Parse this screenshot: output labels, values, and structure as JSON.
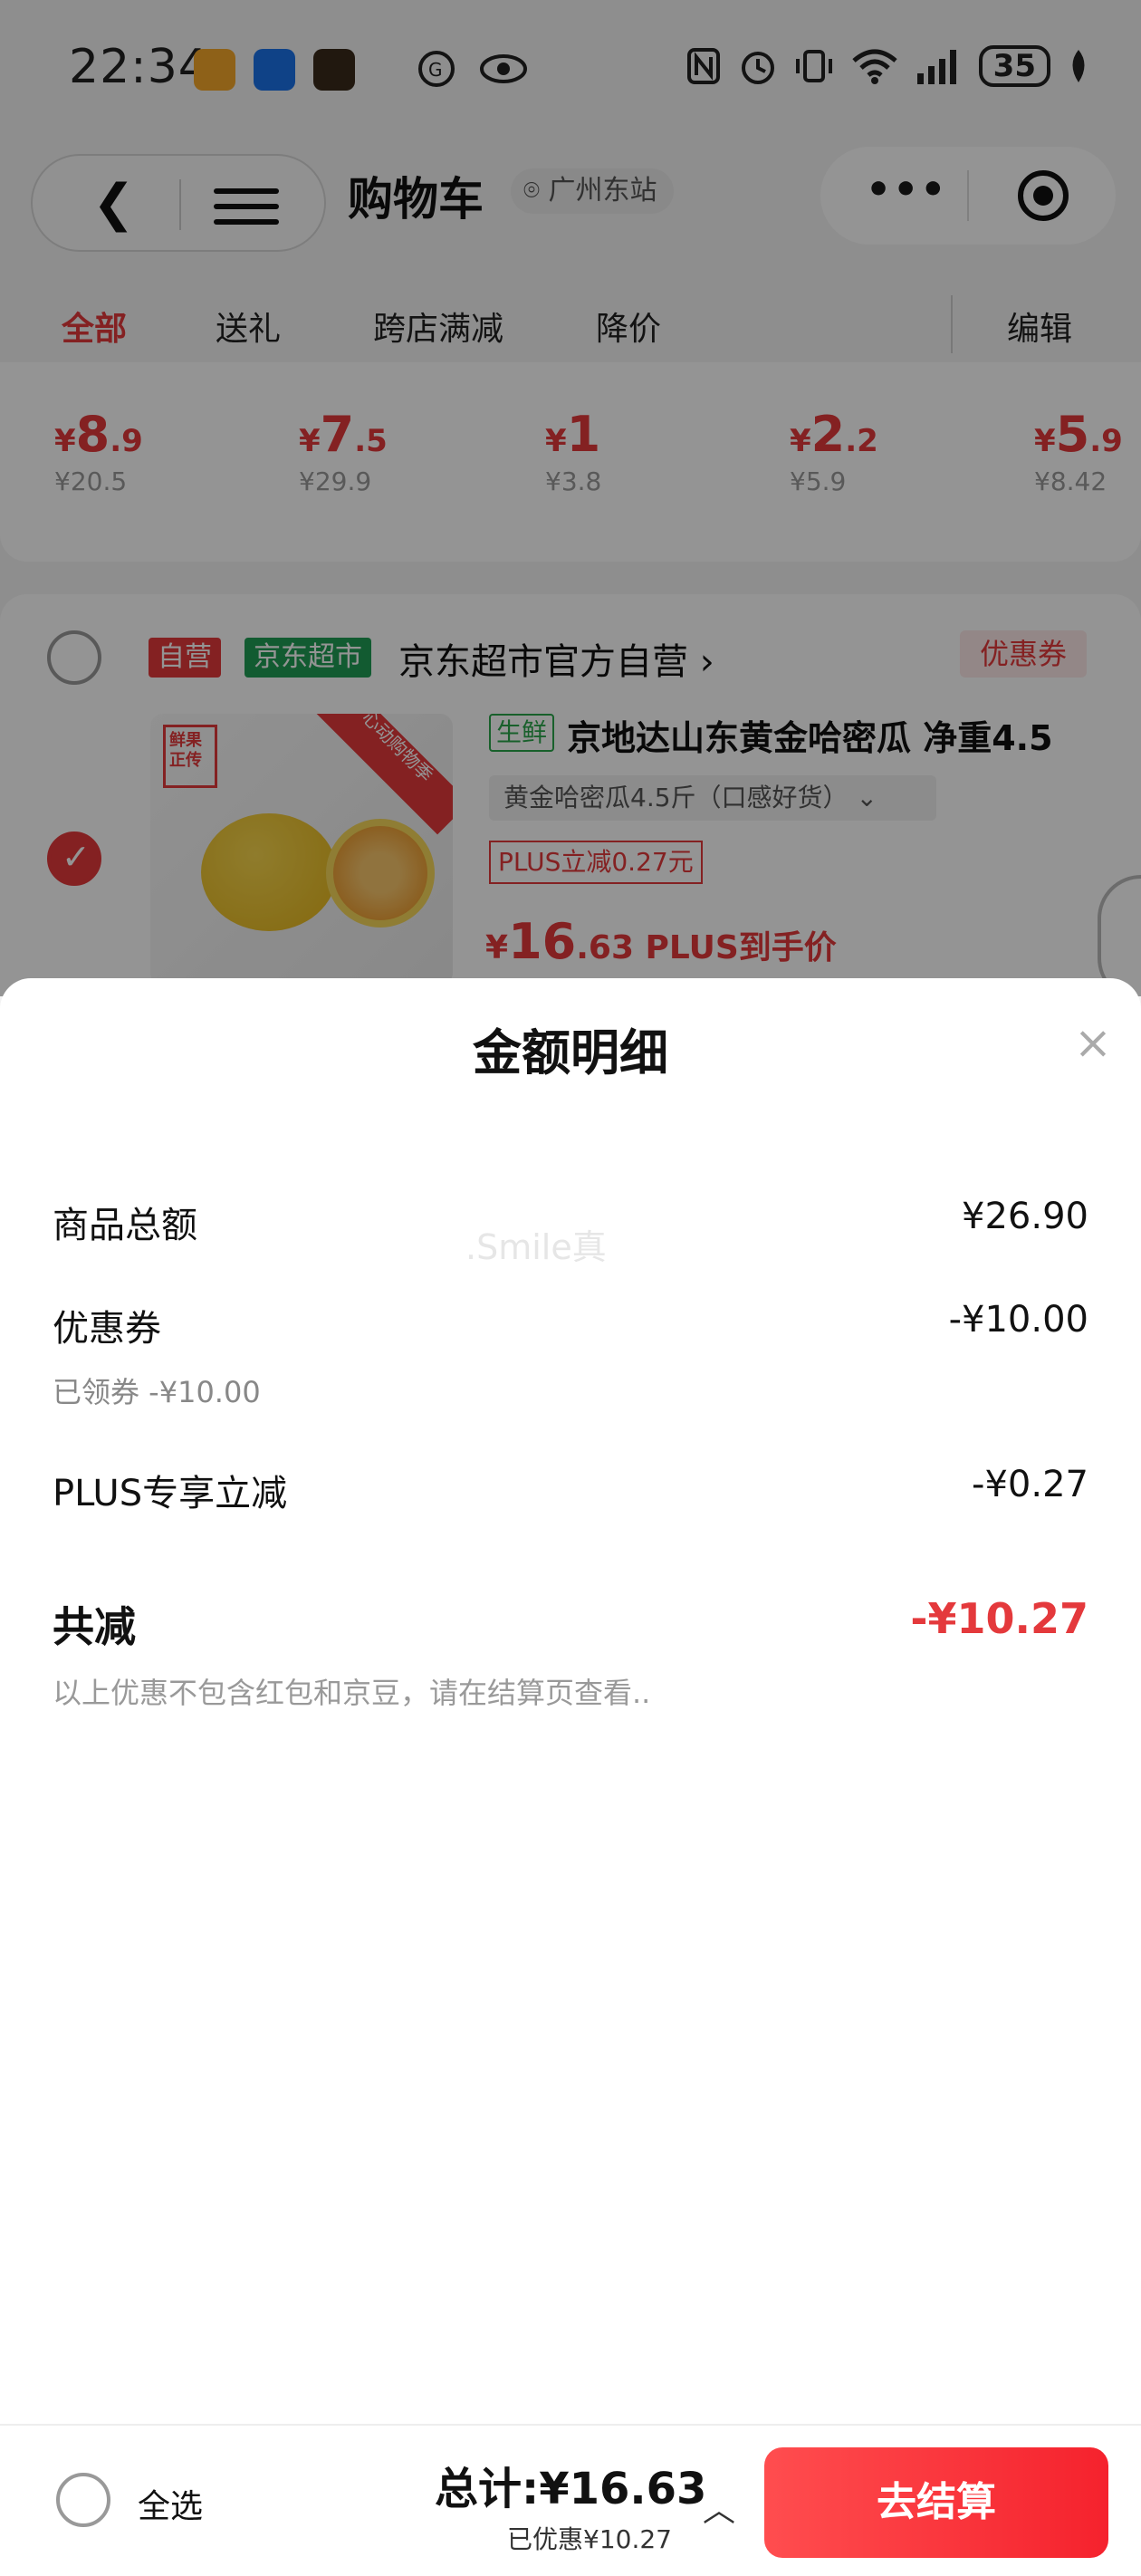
{
  "status_bar": {
    "time": "22:34",
    "battery": "35"
  },
  "nav": {
    "title": "购物车",
    "location": "广州东站"
  },
  "tabs": [
    "全部",
    "送礼",
    "跨店满减",
    "降价"
  ],
  "edit_label": "编辑",
  "recommend": [
    {
      "currency": "¥",
      "int": "8",
      "dec": ".9",
      "orig": "¥20.5"
    },
    {
      "currency": "¥",
      "int": "7",
      "dec": ".5",
      "orig": "¥29.9"
    },
    {
      "currency": "¥",
      "int": "1",
      "dec": "",
      "orig": "¥3.8"
    },
    {
      "currency": "¥",
      "int": "2",
      "dec": ".2",
      "orig": "¥5.9"
    },
    {
      "currency": "¥",
      "int": "5",
      "dec": ".9",
      "orig": "¥8.42"
    }
  ],
  "store": {
    "self_tag": "自营",
    "market_tag": "京东超市",
    "name": "京东超市官方自营",
    "chevron": "›",
    "coupon_tag": "优惠券"
  },
  "product": {
    "fresh_tag": "生鲜",
    "title": "京地达山东黄金哈密瓜 净重4.5",
    "spec": "黄金哈密瓜4.5斤（口感好货）",
    "spec_arrow": "⌄",
    "plus_tag": "PLUS立减0.27元",
    "price_currency": "¥",
    "price_int": "16",
    "price_dec": ".63",
    "price_suffix": "PLUS到手价",
    "img_badge": "鲜果正传",
    "img_ribbon": "心动购物季",
    "selected": true
  },
  "sheet": {
    "title": "金额明细",
    "close": "×",
    "watermark": ".Smile真",
    "rows": {
      "goods_total": {
        "label": "商品总额",
        "value": "¥26.90"
      },
      "coupon": {
        "label": "优惠券",
        "value": "-¥10.00",
        "sub": "已领券 -¥10.00"
      },
      "plus": {
        "label": "PLUS专享立减",
        "value": "-¥0.27"
      }
    },
    "total": {
      "label": "共减",
      "value": "-¥10.27"
    },
    "note": "以上优惠不包含红包和京豆，请在结算页查看.."
  },
  "footer": {
    "select_all": "全选",
    "sum_label": "总计:",
    "sum_value": "¥16.63",
    "saved": "已优惠¥10.27",
    "caret": "︿",
    "checkout": "去结算"
  },
  "colors": {
    "accent": "#e4393c",
    "fresh_green": "#2aa54b",
    "market_green": "#1f9d55",
    "checkout": "#f5222d"
  }
}
